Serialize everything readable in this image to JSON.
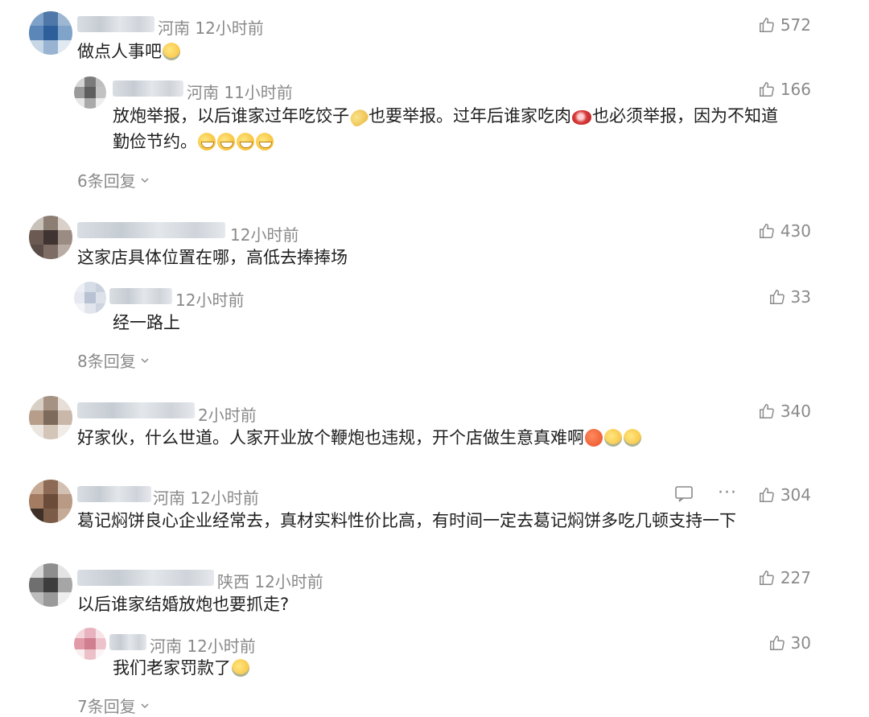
{
  "comments": [
    {
      "location": "河南",
      "time": "12小时前",
      "likes": "572",
      "text": "做点人事吧",
      "emojis": [
        "laugh-cry"
      ],
      "reply": {
        "location": "河南",
        "time": "11小时前",
        "likes": "166",
        "line1_a": "放炮举报，以后谁家过年吃饺子",
        "line1_b": "也要举报。过年后谁家吃肉",
        "line1_c": "也必须举报，因为不知道",
        "line2": "勤俭节约。",
        "emojis": [
          "dumpling",
          "meat",
          "grin",
          "grin",
          "grin",
          "grin"
        ]
      },
      "replies_label": "6条回复"
    },
    {
      "location": "",
      "time": "12小时前",
      "likes": "430",
      "text": "这家店具体位置在哪，高低去捧捧场",
      "reply": {
        "location": "",
        "time": "12小时前",
        "likes": "33",
        "text": "经一路上"
      },
      "replies_label": "8条回复"
    },
    {
      "location": "",
      "time": "2小时前",
      "likes": "340",
      "text": "好家伙，什么世道。人家开业放个鞭炮也违规，开个店做生意真难啊",
      "emojis": [
        "angry",
        "laugh-cry",
        "laugh-cry"
      ]
    },
    {
      "location": "河南",
      "time": "12小时前",
      "likes": "304",
      "text": "葛记焖饼良心企业经常去，真材实料性价比高，有时间一定去葛记焖饼多吃几顿支持一下",
      "more_label": "···"
    },
    {
      "location": "陕西",
      "time": "12小时前",
      "likes": "227",
      "text": "以后谁家结婚放炮也要抓走?",
      "reply": {
        "location": "河南",
        "time": "12小时前",
        "likes": "30",
        "text": "我们老家罚款了",
        "emojis": [
          "laugh-cry"
        ]
      },
      "replies_label": "7条回复"
    }
  ],
  "colors": {
    "meta": "#8a8a8a",
    "text": "#1f1f1f"
  },
  "icons": [
    "thumb-up-icon",
    "chevron-down-icon",
    "comment-icon",
    "more-icon"
  ]
}
